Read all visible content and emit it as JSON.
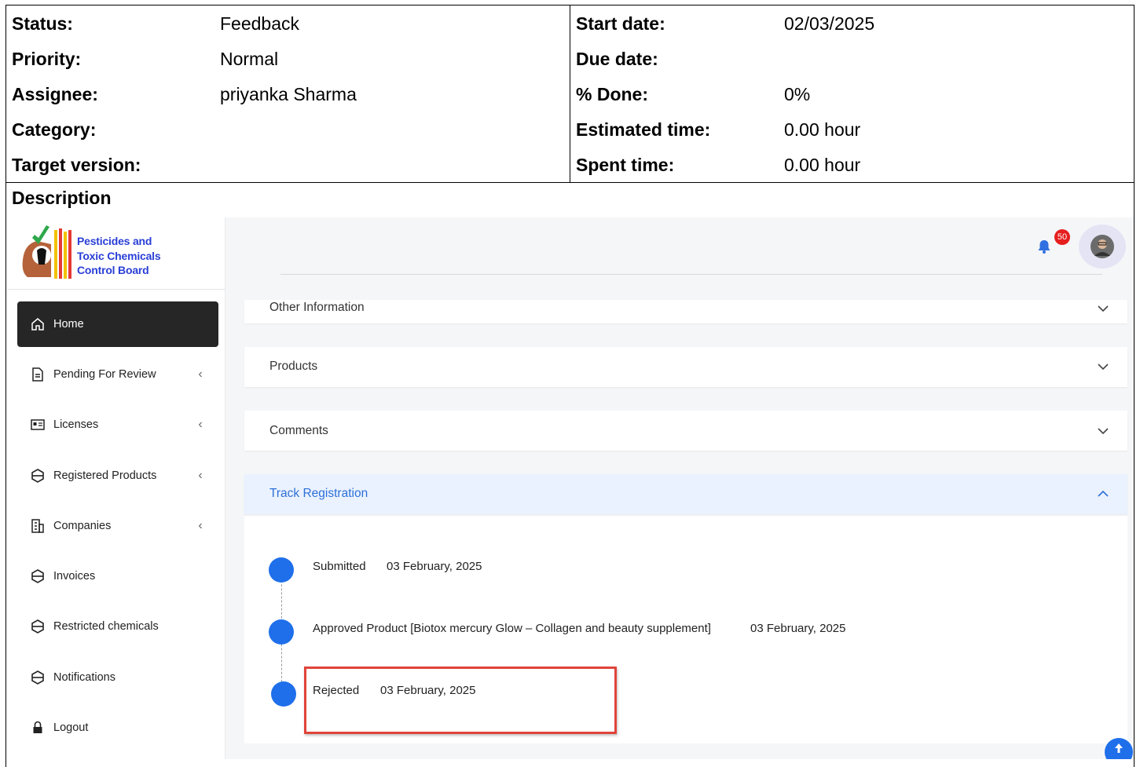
{
  "attributes": {
    "left": [
      {
        "label": "Status:",
        "value": "Feedback"
      },
      {
        "label": "Priority:",
        "value": "Normal"
      },
      {
        "label": "Assignee:",
        "value": "priyanka Sharma"
      },
      {
        "label": "Category:",
        "value": ""
      },
      {
        "label": "Target version:",
        "value": ""
      }
    ],
    "right": [
      {
        "label": "Start date:",
        "value": "02/03/2025"
      },
      {
        "label": "Due date:",
        "value": ""
      },
      {
        "label": "% Done:",
        "value": "0%"
      },
      {
        "label": "Estimated time:",
        "value": "0.00 hour"
      },
      {
        "label": "Spent time:",
        "value": "0.00 hour"
      }
    ]
  },
  "description_label": "Description",
  "app": {
    "logo": {
      "line1": "Pesticides and",
      "line2": "Toxic Chemicals",
      "line3": "Control Board"
    },
    "sidebar": {
      "items": [
        {
          "label": "Home",
          "icon": "home-icon",
          "active": true,
          "has_chevron": false
        },
        {
          "label": "Pending For Review",
          "icon": "document-icon",
          "active": false,
          "has_chevron": true
        },
        {
          "label": "Licenses",
          "icon": "id-card-icon",
          "active": false,
          "has_chevron": true
        },
        {
          "label": "Registered Products",
          "icon": "box-icon",
          "active": false,
          "has_chevron": true
        },
        {
          "label": "Companies",
          "icon": "building-icon",
          "active": false,
          "has_chevron": true
        },
        {
          "label": "Invoices",
          "icon": "box-icon",
          "active": false,
          "has_chevron": false
        },
        {
          "label": "Restricted chemicals",
          "icon": "box-icon",
          "active": false,
          "has_chevron": false
        },
        {
          "label": "Notifications",
          "icon": "box-icon",
          "active": false,
          "has_chevron": false
        },
        {
          "label": "Logout",
          "icon": "lock-icon",
          "active": false,
          "has_chevron": false
        }
      ]
    },
    "header": {
      "notification_count": "50"
    },
    "panels": {
      "other_information": "Other Information",
      "products": "Products",
      "comments": "Comments",
      "track_registration": "Track Registration"
    },
    "timeline": [
      {
        "status": "Submitted",
        "date": "03 February, 2025"
      },
      {
        "status": "Approved Product [Biotox mercury Glow – Collagen and beauty supplement]",
        "date": "03 February, 2025"
      },
      {
        "status": "Rejected",
        "date": "03 February, 2025"
      }
    ],
    "colors": {
      "accent": "#1f6feb",
      "active_nav": "#262626",
      "highlight": "#e0443a",
      "badge": "#e61e1e"
    }
  }
}
